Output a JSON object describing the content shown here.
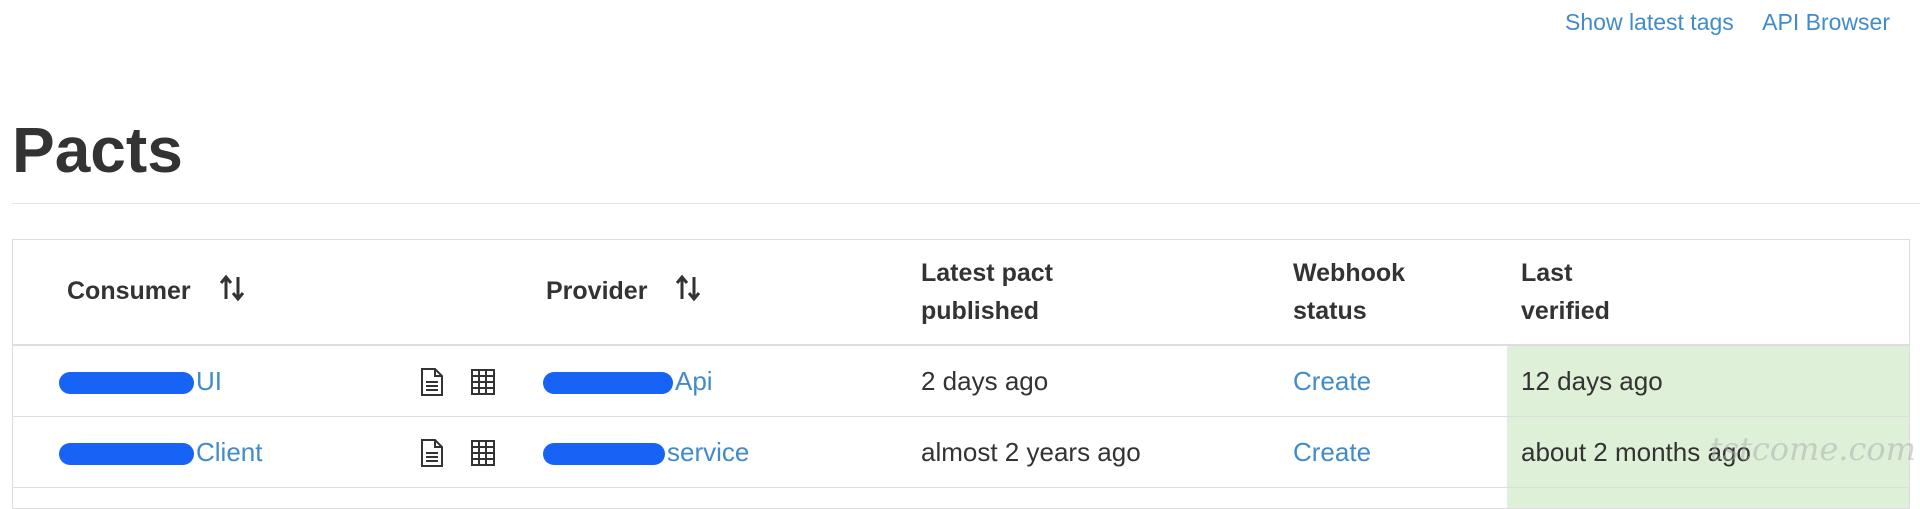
{
  "top_nav": {
    "tags_link": "Show latest tags",
    "api_link": "API Browser"
  },
  "page": {
    "title": "Pacts"
  },
  "table": {
    "headers": {
      "consumer": "Consumer",
      "provider": "Provider",
      "published_line1": "Latest pact",
      "published_line2": "published",
      "webhook_line1": "Webhook",
      "webhook_line2": "status",
      "verified_line1": "Last",
      "verified_line2": "verified"
    },
    "rows": [
      {
        "consumer": "UI",
        "provider": "Api",
        "published": "2 days ago",
        "webhook": "Create",
        "verified": "12 days ago"
      },
      {
        "consumer": "Client",
        "provider": "service",
        "published": "almost 2 years ago",
        "webhook": "Create",
        "verified": "about 2 months ago"
      }
    ]
  },
  "colors": {
    "link": "#428bca",
    "verified_bg": "#dff0d8",
    "redaction": "#1763f6"
  },
  "icons": {
    "sort": "sort-arrows-icon",
    "document": "document-icon",
    "matrix": "table-grid-icon"
  },
  "watermark": "tstcome.com"
}
